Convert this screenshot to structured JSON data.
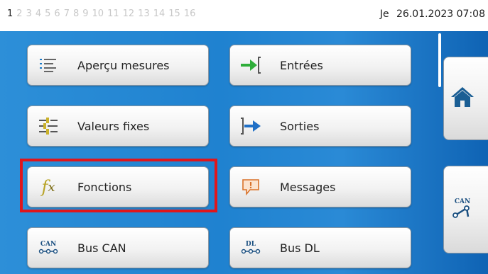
{
  "header": {
    "pages": [
      "1",
      "2",
      "3",
      "4",
      "5",
      "6",
      "7",
      "8",
      "9",
      "10",
      "11",
      "12",
      "13",
      "14",
      "15",
      "16"
    ],
    "active_page": "1",
    "day": "Je",
    "date": "26.01.2023",
    "time": "07:08"
  },
  "menu": {
    "apercu": "Aperçu mesures",
    "entrees": "Entrées",
    "valeurs": "Valeurs fixes",
    "sorties": "Sorties",
    "fonctions": "Fonctions",
    "messages": "Messages",
    "buscan": "Bus CAN",
    "busdl": "Bus DL"
  },
  "icons": {
    "apercu": "list-icon",
    "entrees": "input-arrow-icon",
    "valeurs": "fixed-values-icon",
    "sorties": "output-arrow-icon",
    "fonctions": "function-fx-icon",
    "messages": "message-alert-icon",
    "buscan": "can-bus-icon",
    "busdl": "dl-bus-icon",
    "home": "home-icon",
    "can_side": "can-network-icon"
  },
  "icon_text": {
    "fx_f": "f",
    "fx_x": "x",
    "can": "CAN",
    "dl": "DL",
    "excl": "!"
  },
  "colors": {
    "background": "#1f82d0",
    "highlight": "#e0161b",
    "accent_green": "#2fae3a",
    "home": "#1a5e94"
  }
}
